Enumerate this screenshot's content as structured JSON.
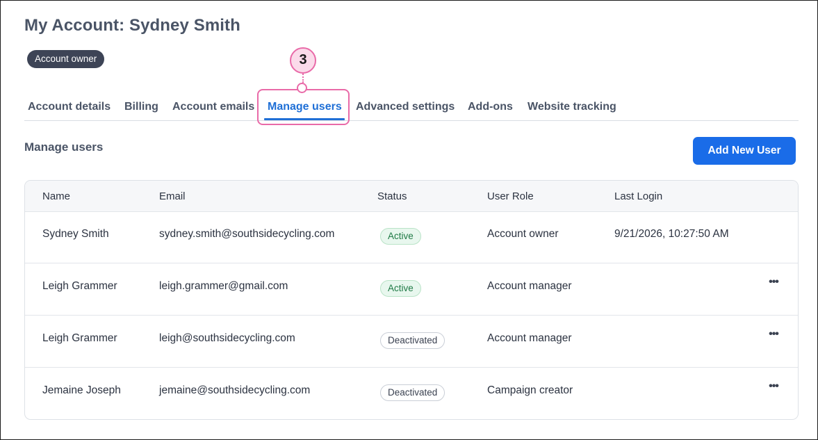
{
  "header": {
    "title": "My Account: Sydney Smith",
    "role_badge": "Account owner"
  },
  "tabs": [
    {
      "label": "Account details",
      "active": false
    },
    {
      "label": "Billing",
      "active": false
    },
    {
      "label": "Account emails",
      "active": false
    },
    {
      "label": "Manage users",
      "active": true
    },
    {
      "label": "Advanced settings",
      "active": false
    },
    {
      "label": "Add-ons",
      "active": false
    },
    {
      "label": "Website tracking",
      "active": false
    }
  ],
  "callout": {
    "number": "3",
    "color": "#e96aa8"
  },
  "section": {
    "title": "Manage users",
    "add_button": "Add New User"
  },
  "table": {
    "columns": [
      "Name",
      "Email",
      "Status",
      "User Role",
      "Last Login"
    ],
    "rows": [
      {
        "name": "Sydney Smith",
        "email": "sydney.smith@southsidecycling.com",
        "status": "Active",
        "role": "Account owner",
        "last_login": "9/21/2026, 10:27:50 AM",
        "menu": ""
      },
      {
        "name": "Leigh Grammer",
        "email": "leigh.grammer@gmail.com",
        "status": "Active",
        "role": "Account manager",
        "last_login": "",
        "menu": "•••"
      },
      {
        "name": "Leigh Grammer",
        "email": "leigh@southsidecycling.com",
        "status": "Deactivated",
        "role": "Account manager",
        "last_login": "",
        "menu": "•••"
      },
      {
        "name": "Jemaine Joseph",
        "email": "jemaine@southsidecycling.com",
        "status": "Deactivated",
        "role": "Campaign creator",
        "last_login": "",
        "menu": "•••"
      }
    ]
  },
  "colors": {
    "accent": "#1f6fd6",
    "button": "#1a6ce8",
    "badge": "#3d4456",
    "status_active": "#1f7a45"
  }
}
